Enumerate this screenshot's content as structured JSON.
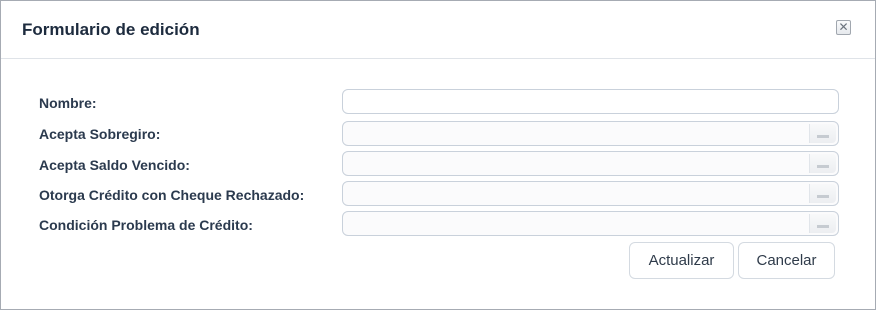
{
  "dialog": {
    "title": "Formulario de edición",
    "close_glyph": "✕",
    "close_icon": "close-icon"
  },
  "form": {
    "fields": [
      {
        "label": "Nombre:",
        "type": "text",
        "value": ""
      },
      {
        "label": "Acepta Sobregiro:",
        "type": "select",
        "value": ""
      },
      {
        "label": "Acepta Saldo Vencido:",
        "type": "select",
        "value": ""
      },
      {
        "label": "Otorga Crédito con Cheque Rechazado:",
        "type": "select",
        "value": ""
      },
      {
        "label": "Condición Problema de Crédito:",
        "type": "select",
        "value": ""
      }
    ]
  },
  "buttons": {
    "update_label": "Actualizar",
    "cancel_label": "Cancelar"
  }
}
